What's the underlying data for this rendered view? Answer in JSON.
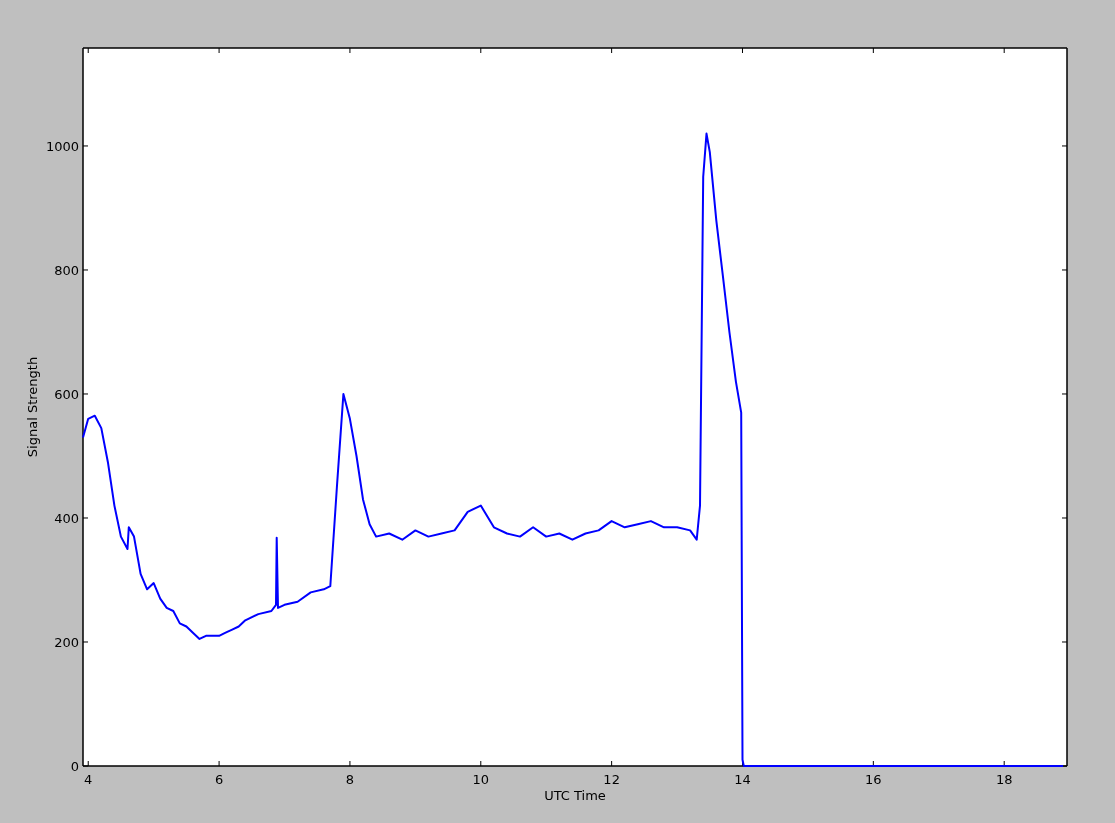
{
  "chart_data": {
    "type": "line",
    "xlabel": "UTC Time",
    "ylabel": "Signal Strength",
    "x": [
      3.92,
      4.0,
      4.1,
      4.2,
      4.3,
      4.4,
      4.5,
      4.6,
      4.62,
      4.7,
      4.8,
      4.9,
      5.0,
      5.1,
      5.2,
      5.3,
      5.4,
      5.5,
      5.6,
      5.7,
      5.8,
      6.0,
      6.1,
      6.2,
      6.3,
      6.4,
      6.6,
      6.8,
      6.87,
      6.88,
      6.9,
      7.0,
      7.2,
      7.4,
      7.6,
      7.7,
      7.8,
      7.9,
      8.0,
      8.1,
      8.2,
      8.3,
      8.4,
      8.6,
      8.8,
      9.0,
      9.2,
      9.4,
      9.6,
      9.8,
      10.0,
      10.2,
      10.4,
      10.6,
      10.8,
      11.0,
      11.2,
      11.4,
      11.6,
      11.8,
      12.0,
      12.2,
      12.4,
      12.6,
      12.8,
      13.0,
      13.2,
      13.3,
      13.35,
      13.4,
      13.45,
      13.5,
      13.6,
      13.7,
      13.8,
      13.9,
      13.98,
      14.0,
      14.02,
      18.9
    ],
    "series": [
      {
        "color": "#0000ff",
        "values": [
          530,
          560,
          565,
          545,
          490,
          420,
          370,
          350,
          385,
          370,
          310,
          285,
          295,
          270,
          255,
          250,
          230,
          225,
          215,
          205,
          210,
          210,
          215,
          220,
          225,
          235,
          245,
          250,
          260,
          368,
          255,
          260,
          265,
          280,
          285,
          290,
          450,
          600,
          560,
          500,
          430,
          390,
          370,
          375,
          365,
          380,
          370,
          375,
          380,
          410,
          420,
          385,
          375,
          370,
          385,
          370,
          375,
          365,
          375,
          380,
          395,
          385,
          390,
          395,
          385,
          385,
          380,
          365,
          420,
          950,
          1020,
          990,
          880,
          790,
          700,
          620,
          570,
          10,
          0,
          0
        ]
      }
    ],
    "xlim": [
      3.92,
      18.96
    ],
    "ylim": [
      0,
      1158
    ],
    "xticks": [
      4,
      6,
      8,
      10,
      12,
      14,
      16,
      18
    ],
    "yticks": [
      0,
      200,
      400,
      600,
      800,
      1000
    ]
  }
}
